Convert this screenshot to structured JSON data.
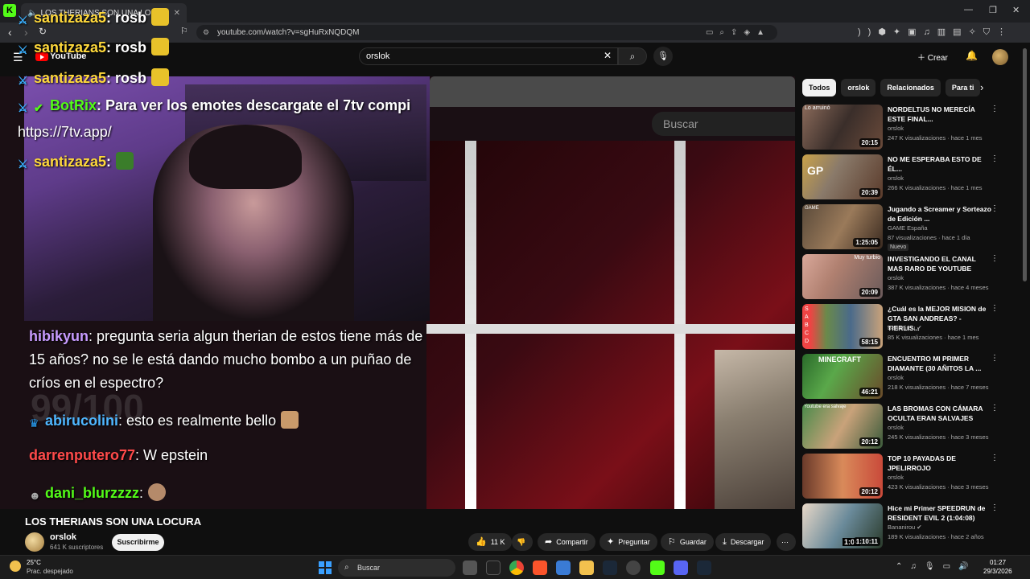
{
  "browser": {
    "tab_title": "LOS THERIANS SON UNA LO",
    "url": "youtube.com/watch?v=sgHuRxNQDQM"
  },
  "youtube": {
    "logo_text": "YouTube",
    "search_value": "orslok",
    "create_label": "Crear"
  },
  "player": {
    "inner_search_placeholder": "Buscar",
    "score_text": "99/100",
    "top_chat": [
      {
        "user": "santizaza5",
        "text": ": rosb"
      },
      {
        "user": "santizaza5",
        "text": ": rosb"
      },
      {
        "user": "santizaza5",
        "text": ": rosb"
      },
      {
        "user": "BotRix",
        "text": ": Para ver los emotes descargate el 7tv compi"
      },
      {
        "user": "",
        "text": "https://7tv.app/"
      },
      {
        "user": "santizaza5",
        "text": ":"
      }
    ],
    "bottom_chat": [
      {
        "user": "hibikyun",
        "text": ": pregunta seria algun therian de estos tiene más de"
      },
      {
        "user": "",
        "text": "15 años? no se le está dando mucho bombo a un puñao de"
      },
      {
        "user": "",
        "text": "críos en el espectro?"
      },
      {
        "user": "abirucolini",
        "text": ": esto es realmente bello"
      },
      {
        "user": "darrenputero77",
        "text": ": W epstein"
      },
      {
        "user": "dani_blurzzzz",
        "text": ":"
      }
    ]
  },
  "video": {
    "title": "LOS THERIANS SON UNA LOCURA",
    "channel": "orslok",
    "subscribers": "641 K suscriptores",
    "subscribe_label": "Suscribirme",
    "likes": "11 K",
    "share_label": "Compartir",
    "ask_label": "Preguntar",
    "save_label": "Guardar",
    "download_label": "Descargar"
  },
  "chips": [
    "Todos",
    "orslok",
    "Relacionados",
    "Para ti"
  ],
  "recommendations": [
    {
      "title": "NORDELTUS NO MERECÍA ESTE FINAL...",
      "channel": "orslok",
      "meta": "247 K visualizaciones · hace 1 mes",
      "duration": "20:15",
      "thumb_overlay": "Lo arruinó"
    },
    {
      "title": "NO ME ESPERABA ESTO DE ÉL...",
      "channel": "orslok",
      "meta": "266 K visualizaciones · hace 1 mes",
      "duration": "20:39",
      "thumb_overlay": "GP"
    },
    {
      "title": "Jugando a Screamer y Sorteazo de Edición ...",
      "channel": "GAME España",
      "meta": "87 visualizaciones · hace 1 día",
      "duration": "1:25:05",
      "badge": "Nuevo",
      "thumb_overlay": "GAME"
    },
    {
      "title": "INVESTIGANDO EL CANAL MAS RARO DE YOUTUBE",
      "channel": "orslok",
      "meta": "387 K visualizaciones · hace 4 meses",
      "duration": "20:09",
      "thumb_overlay": "Muy turbio"
    },
    {
      "title": "¿Cuál es la MEJOR MISION de GTA SAN ANDREAS? - TIERLIS...",
      "channel": "Bananirou",
      "meta": "85 K visualizaciones · hace 1 mes",
      "duration": "58:15",
      "thumb_overlay": "S A B C D"
    },
    {
      "title": "ENCUENTRO MI PRIMER DIAMANTE (30 AÑITOS LA ...",
      "channel": "orslok",
      "meta": "218 K visualizaciones · hace 7 meses",
      "duration": "46:21",
      "thumb_overlay": "MINECRAFT"
    },
    {
      "title": "LAS BROMAS CON CÁMARA OCULTA ERAN SALVAJES",
      "channel": "orslok",
      "meta": "245 K visualizaciones · hace 3 meses",
      "duration": "20:12",
      "thumb_overlay": "Youtube era salvaje"
    },
    {
      "title": "TOP 10 PAYADAS DE JPELIRROJO",
      "channel": "orslok",
      "meta": "423 K visualizaciones · hace 3 meses",
      "duration": "20:12",
      "thumb_overlay": ""
    },
    {
      "title": "Hice mi Primer SPEEDRUN de RESIDENT EVIL 2 (1:04:08)",
      "channel": "Bananirou",
      "meta": "189 K visualizaciones · hace 2 años",
      "duration": "1:10:11",
      "thumb_overlay": "1:04"
    }
  ],
  "taskbar": {
    "temp": "25°C",
    "weather": "Prac. despejado",
    "search_placeholder": "Buscar",
    "time": "01:27",
    "date": "29/3/2026"
  }
}
